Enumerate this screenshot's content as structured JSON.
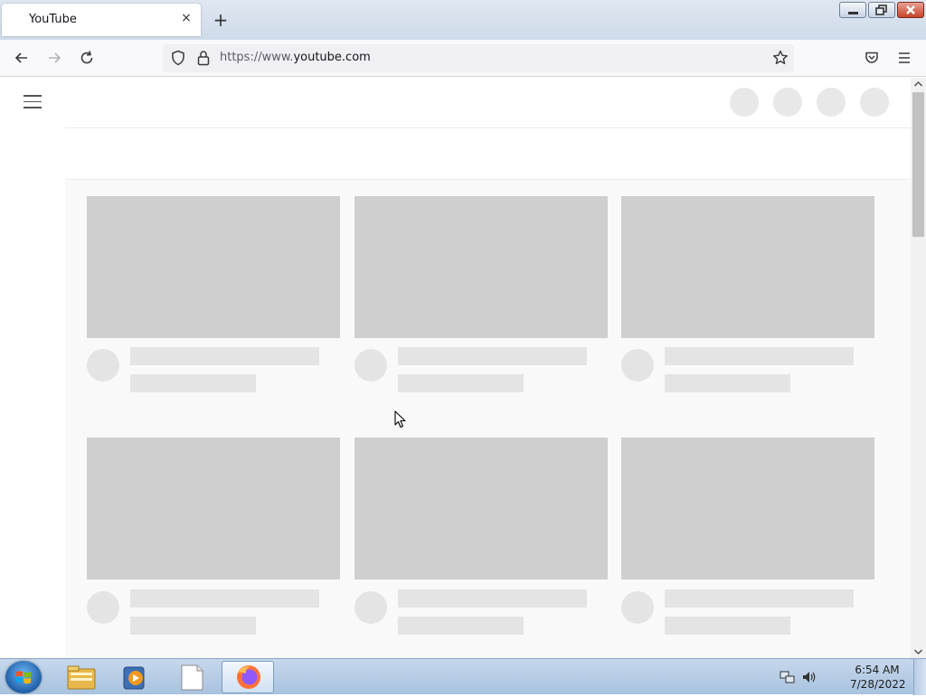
{
  "browser": {
    "tab_title": "YouTube",
    "tab_close_glyph": "×",
    "new_tab_glyph": "+",
    "url_prefix": "https://www.",
    "url_domain": "youtube.com",
    "window_buttons": [
      "minimize",
      "restore",
      "close"
    ]
  },
  "page": {
    "header_circles": 4,
    "video_rows": 2,
    "video_columns": 3,
    "skeleton_colors": {
      "thumbnail": "#cfcfcf",
      "placeholder": "#e4e4e4",
      "background": "#f9f9f9"
    }
  },
  "taskbar": {
    "items": [
      "start-button",
      "windows-explorer",
      "media-player",
      "notepad",
      "firefox"
    ],
    "active_item": "firefox",
    "clock_time": "6:54 AM",
    "clock_date": "7/28/2022"
  }
}
